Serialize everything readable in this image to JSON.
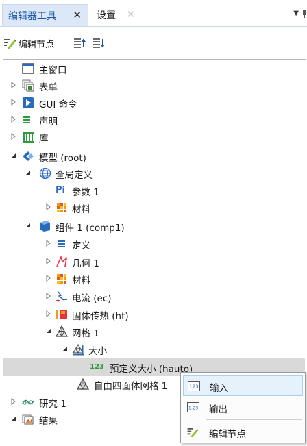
{
  "tabs": [
    {
      "label": "编辑器工具",
      "close": "✕"
    },
    {
      "label": "设置",
      "close": "✕"
    }
  ],
  "pane_menu": "▼",
  "toolbar": {
    "edit_node_label": "编辑节点"
  },
  "tree": {
    "items": [
      {
        "label": "主窗口",
        "icon": "window-icon"
      },
      {
        "label": "表单",
        "icon": "form-icon"
      },
      {
        "label": "GUI 命令",
        "icon": "gui-command-icon"
      },
      {
        "label": "声明",
        "icon": "declarations-icon"
      },
      {
        "label": "库",
        "icon": "library-icon"
      },
      {
        "label": "模型 (root)",
        "icon": "model-icon"
      },
      {
        "label": "全局定义",
        "icon": "global-definitions-icon"
      },
      {
        "label": "参数 1",
        "icon": "parameters-icon",
        "icon_text": "Pi"
      },
      {
        "label": "材料",
        "icon": "materials-icon"
      },
      {
        "label": "组件 1 (comp1)",
        "icon": "component-icon"
      },
      {
        "label": "定义",
        "icon": "definitions-icon"
      },
      {
        "label": "几何 1",
        "icon": "geometry-icon"
      },
      {
        "label": "材料",
        "icon": "materials-icon"
      },
      {
        "label": "电流 (ec)",
        "icon": "electric-currents-icon"
      },
      {
        "label": "固体传热 (ht)",
        "icon": "heat-transfer-icon"
      },
      {
        "label": "网格 1",
        "icon": "mesh-icon"
      },
      {
        "label": "大小",
        "icon": "size-icon"
      },
      {
        "label": "预定义大小 (hauto)",
        "icon": "predefined-size-icon",
        "icon_text": "123"
      },
      {
        "label": "自由四面体网格 1",
        "icon": "free-tetrahedral-icon"
      },
      {
        "label": "研究 1",
        "icon": "study-icon"
      },
      {
        "label": "结果",
        "icon": "results-icon"
      }
    ]
  },
  "context_menu": {
    "items": [
      {
        "label": "输入",
        "icon": "input-icon",
        "icon_text": "123"
      },
      {
        "label": "输出",
        "icon": "output-icon",
        "icon_text": "1.23"
      },
      {
        "label": "编辑节点",
        "icon": "edit-node-icon"
      }
    ]
  },
  "colors": {
    "accent": "#1e5aa8",
    "selection": "#d9d9d9",
    "menu_hover": "#e5f1fb",
    "materials": "#f39a1e",
    "green": "#2e9b3e"
  }
}
